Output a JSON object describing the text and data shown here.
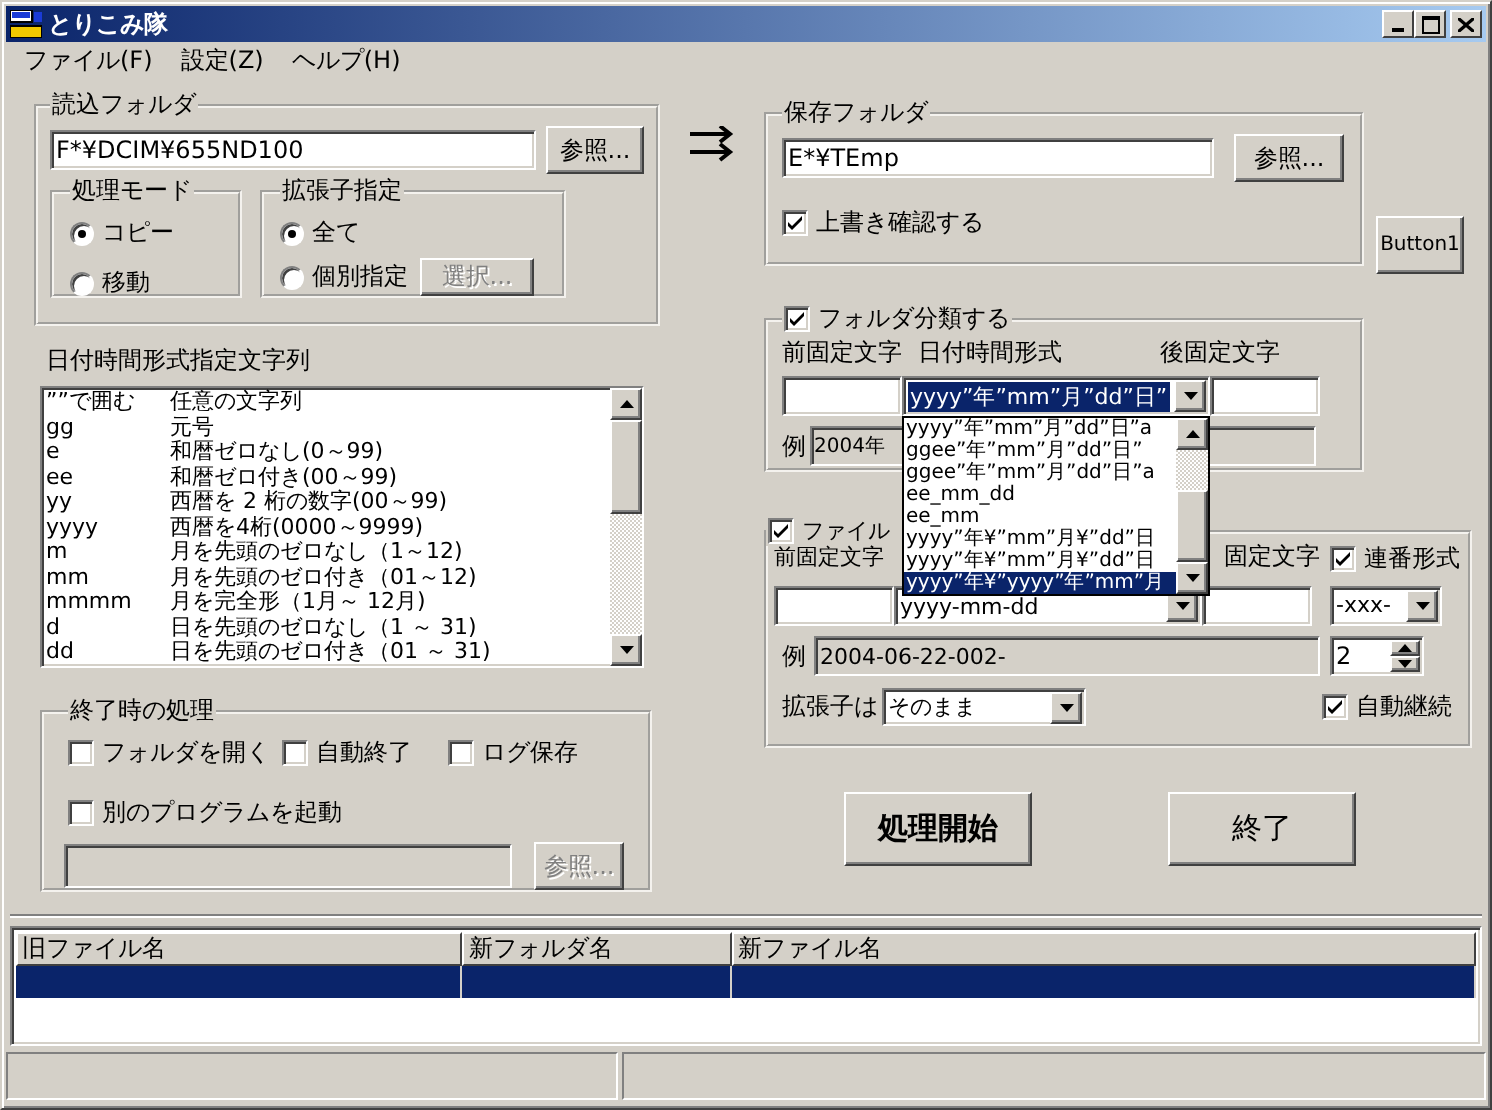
{
  "window": {
    "title": "とりこみ隊"
  },
  "menu": [
    {
      "label": "ファイル(F)"
    },
    {
      "label": "設定(Z)"
    },
    {
      "label": "ヘルプ(H)"
    }
  ],
  "source_folder": {
    "title": "読込フォルダ",
    "path": "F*¥DCIM¥655ND100",
    "browse": "参照...",
    "mode": {
      "title": "処理モード",
      "options": [
        {
          "label": "コピー",
          "selected": true
        },
        {
          "label": "移動",
          "selected": false
        }
      ]
    },
    "extension": {
      "title": "拡張子指定",
      "options": [
        {
          "label": "全て",
          "selected": true
        },
        {
          "label": "個別指定",
          "selected": false
        }
      ],
      "select_button": {
        "label": "選択...",
        "disabled": true
      }
    }
  },
  "format_list": {
    "title": "日付時間形式指定文字列",
    "rows": [
      {
        "code": "””で囲む",
        "description": "任意の文字列"
      },
      {
        "code": "gg",
        "description": "元号"
      },
      {
        "code": "e",
        "description": "和暦ゼロなし(0～99)"
      },
      {
        "code": "ee",
        "description": "和暦ゼロ付き(00～99)"
      },
      {
        "code": "yy",
        "description": "西暦を 2 桁の数字(00～99)"
      },
      {
        "code": "yyyy",
        "description": "西暦を4桁(0000～9999)"
      },
      {
        "code": "m",
        "description": "月を先頭のゼロなし（1～12)"
      },
      {
        "code": "mm",
        "description": "月を先頭のゼロ付き（01～12)"
      },
      {
        "code": "mmmm",
        "description": "月を完全形（1月～ 12月)"
      },
      {
        "code": "d",
        "description": "日を先頭のゼロなし（1 ～ 31)"
      },
      {
        "code": "dd",
        "description": "日を先頭のゼロ付き（01 ～ 31)"
      }
    ]
  },
  "on_finish": {
    "title": "終了時の処理",
    "options": [
      {
        "label": "フォルダを開く",
        "checked": false
      },
      {
        "label": "自動終了",
        "checked": false
      },
      {
        "label": "ログ保存",
        "checked": false
      }
    ],
    "run_program": {
      "label": "別のプログラムを起動",
      "checked": false
    },
    "program_field": {
      "disabled": true
    },
    "browse": {
      "label": "参照...",
      "disabled": true
    }
  },
  "dest_folder": {
    "title": "保存フォルダ",
    "path": "E*¥TEmp",
    "browse": "参照...",
    "confirm_overwrite": {
      "label": "上書き確認する",
      "checked": true
    }
  },
  "side_button": {
    "label": "Button1"
  },
  "folder_sort": {
    "title": "フォルダ分類する",
    "checked": true,
    "prefix_label": "前固定文字",
    "format_label": "日付時間形式",
    "suffix_label": "後固定文字",
    "format_value": "yyyy”年”mm”月”dd”日”",
    "example_label": "例",
    "example": "2004年",
    "dropdown": {
      "items": [
        {
          "label": "yyyy”年”mm”月”dd”日”a",
          "selected": false
        },
        {
          "label": "ggee”年”mm”月”dd”日”",
          "selected": false
        },
        {
          "label": "ggee”年”mm”月”dd”日”a",
          "selected": false
        },
        {
          "label": "ee_mm_dd",
          "selected": false
        },
        {
          "label": "ee_mm",
          "selected": false
        },
        {
          "label": "yyyy”年¥”mm”月¥”dd”日",
          "selected": false
        },
        {
          "label": "yyyy”年¥”mm”月¥”dd”日",
          "selected": false
        },
        {
          "label": "yyyy”年¥”yyyy”年”mm”月",
          "selected": true
        }
      ]
    }
  },
  "file_rename": {
    "title": "ファイル",
    "checked": true,
    "prefix_label": "前固定文字",
    "suffix_label": "固定文字",
    "format_value": "yyyy-mm-dd",
    "serial": {
      "label": "連番形式",
      "checked": true
    },
    "serial_format": "-xxx-",
    "example_label": "例",
    "example": "2004-06-22-002-",
    "digits": "2",
    "ext_label": "拡張子は",
    "ext_value": "そのまま",
    "auto_continue": {
      "label": "自動継続",
      "checked": true
    }
  },
  "actions": [
    {
      "label": "処理開始",
      "kind": "primary"
    },
    {
      "label": "終了",
      "kind": "normal"
    }
  ],
  "table": {
    "columns": [
      "旧ファイル名",
      "新フォルダ名",
      "新ファイル名"
    ],
    "rows": [
      {
        "selected": true
      }
    ]
  }
}
